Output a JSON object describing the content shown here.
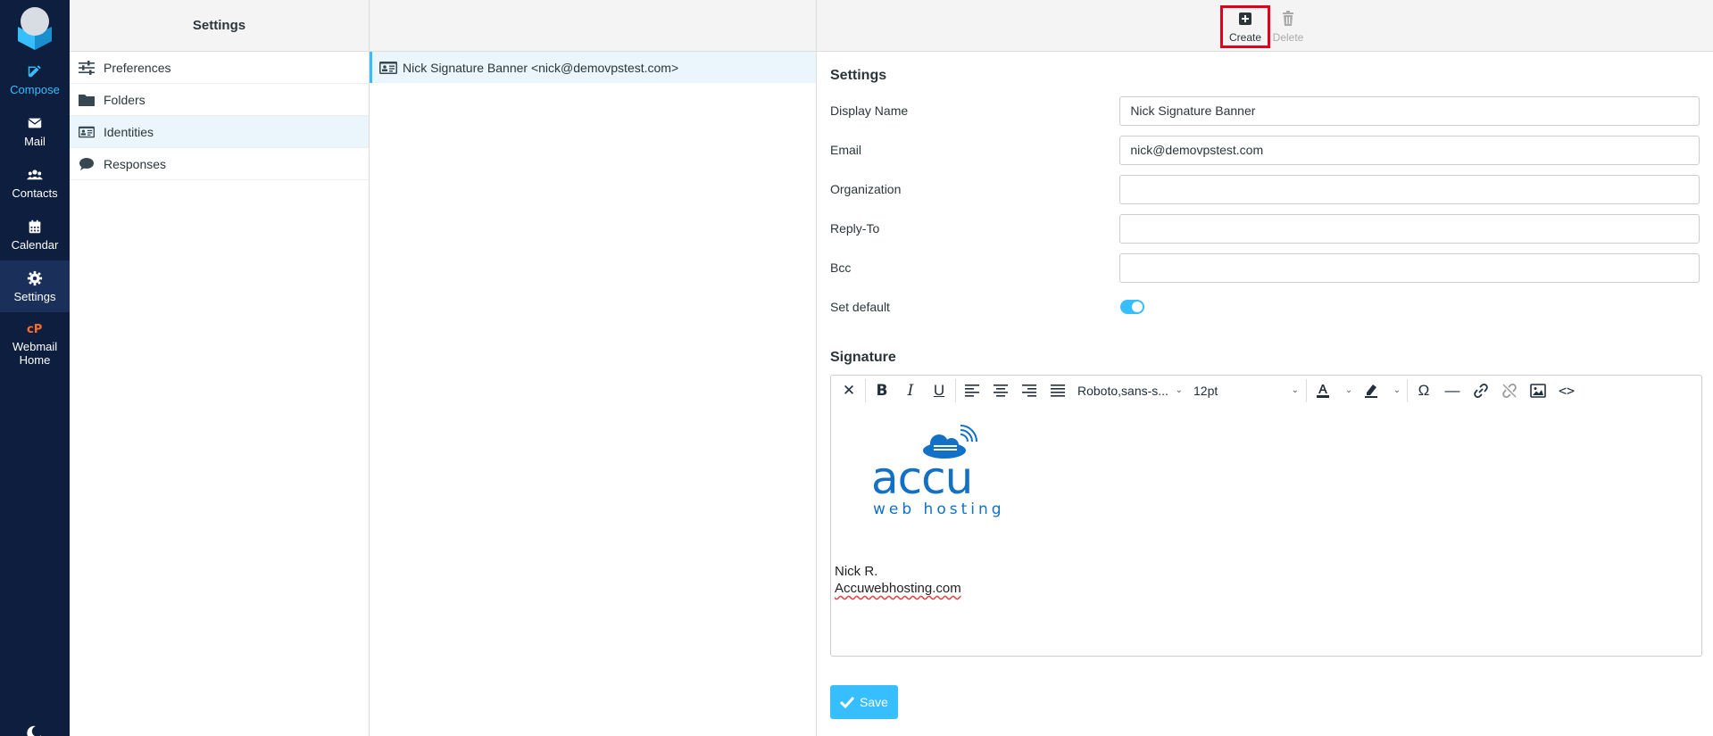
{
  "nav": {
    "items": [
      {
        "label": "Compose"
      },
      {
        "label": "Mail"
      },
      {
        "label": "Contacts"
      },
      {
        "label": "Calendar"
      },
      {
        "label": "Settings"
      },
      {
        "label": "Webmail Home"
      }
    ]
  },
  "settings_panel": {
    "title": "Settings",
    "items": [
      {
        "label": "Preferences"
      },
      {
        "label": "Folders"
      },
      {
        "label": "Identities"
      },
      {
        "label": "Responses"
      }
    ]
  },
  "identities": {
    "items": [
      {
        "label": "Nick Signature Banner <nick@demovpstest.com>"
      }
    ]
  },
  "toolbar": {
    "create_label": "Create",
    "delete_label": "Delete"
  },
  "form": {
    "section_title": "Settings",
    "display_name_label": "Display Name",
    "display_name_value": "Nick Signature Banner",
    "email_label": "Email",
    "email_value": "nick@demovpstest.com",
    "organization_label": "Organization",
    "organization_value": "",
    "reply_to_label": "Reply-To",
    "reply_to_value": "",
    "bcc_label": "Bcc",
    "bcc_value": "",
    "set_default_label": "Set default",
    "set_default_on": true
  },
  "signature": {
    "title": "Signature",
    "font_family": "Roboto,sans-s...",
    "font_size": "12pt",
    "logo_text": "accu",
    "logo_subtext": "web hosting",
    "line1": "Nick R.",
    "line2": "Accuwebhosting.com"
  },
  "save_label": "Save",
  "colors": {
    "nav_bg": "#0e1e3f",
    "accent": "#37beff",
    "highlight_border": "#e0001b",
    "logo_blue": "#1270c6"
  }
}
